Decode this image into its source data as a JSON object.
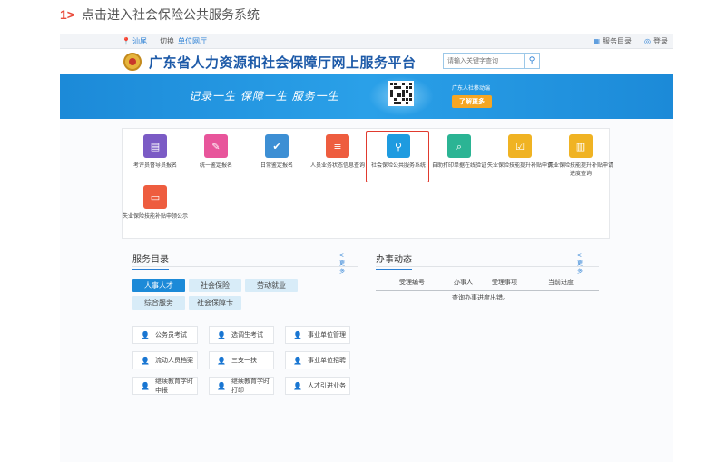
{
  "step": {
    "number": "1>",
    "text": "点击进入社会保险公共服务系统"
  },
  "topbar": {
    "location": "汕尾",
    "switch": "切换",
    "hall": "单位网厅",
    "catalog": "服务目录",
    "login": "登录"
  },
  "header": {
    "title": "广东省人力资源和社会保障厅网上服务平台",
    "search_placeholder": "请输入关键字查询"
  },
  "banner": {
    "slogan": "记录一生  保障一生  服务一生",
    "app_title": "广东人社移动端",
    "more_button": "了解更多"
  },
  "services": [
    {
      "label": "考评员督导员报名",
      "icon": "id-card-icon",
      "color": "#7b5bc5"
    },
    {
      "label": "统一鉴定报名",
      "icon": "certificate-icon",
      "color": "#e8559b"
    },
    {
      "label": "日常鉴定报名",
      "icon": "badge-check-icon",
      "color": "#3d8fd4"
    },
    {
      "label": "人员业务状态信息查询",
      "icon": "user-card-icon",
      "color": "#ee5d3f"
    },
    {
      "label": "社会保险公共服务系统",
      "icon": "user-search-icon",
      "color": "#1e9be0"
    },
    {
      "label": "自助打印单据在线验证",
      "icon": "document-search-icon",
      "color": "#2bb494"
    },
    {
      "label": "失业保险技能提升补贴申请",
      "icon": "checklist-icon",
      "color": "#f0b323"
    },
    {
      "label": "失业保险技能提升补贴申请进度查询",
      "icon": "document-progress-icon",
      "color": "#f0b323"
    },
    {
      "label": "失业保险技能补贴申领公示",
      "icon": "notice-card-icon",
      "color": "#ee5d3f"
    }
  ],
  "catalog": {
    "title": "服务目录",
    "more": "<更多",
    "tabs": [
      "人事人才",
      "社会保险",
      "劳动就业",
      "综合服务",
      "社会保障卡"
    ],
    "items": [
      "公务员考试",
      "选调生考试",
      "事业单位管理",
      "流动人员档案",
      "三支一扶",
      "事业单位招聘",
      "继续教育学时申报",
      "继续教育学时打印",
      "人才引进业务"
    ]
  },
  "progress": {
    "title": "办事动态",
    "more": "<更多",
    "columns": [
      "受理编号",
      "办事人",
      "受理事项",
      "当前进度"
    ],
    "message": "查询办事进度出错。"
  }
}
